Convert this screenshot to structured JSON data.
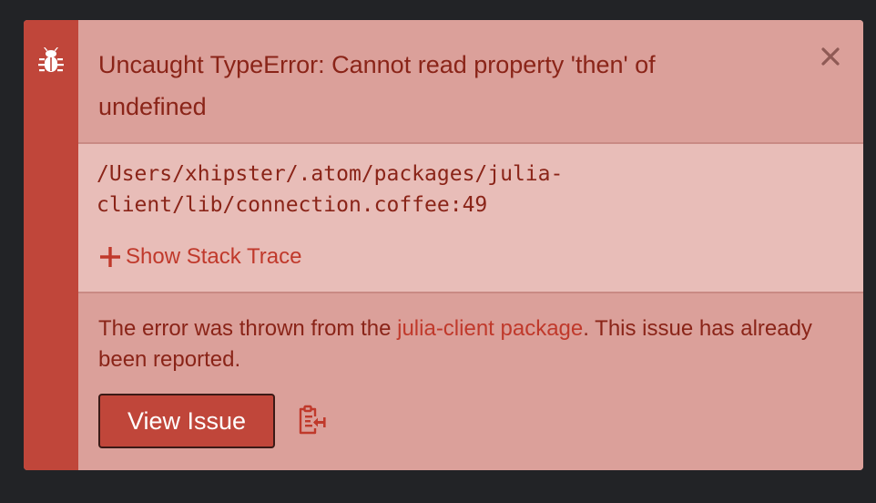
{
  "notification": {
    "type": "error",
    "icon": "bug-icon",
    "message": "Uncaught TypeError: Cannot read property 'then' of undefined",
    "close_icon": "close-icon",
    "detail_path": "/Users/xhipster/.atom/packages/julia-\nclient/lib/connection.coffee:49",
    "stack_toggle_label": "Show Stack Trace",
    "meta": {
      "prefix": "The error was thrown from the ",
      "package_link": "julia-client package",
      "suffix": ". This issue has already been reported."
    },
    "view_issue_label": "View Issue",
    "copy_icon": "clipboard-copy-icon"
  },
  "colors": {
    "background": "#222326",
    "accent": "#c0463a",
    "panel": "#dba09a",
    "detail_panel": "#e8bdb8",
    "text": "#8a2418",
    "link": "#c0392b"
  }
}
